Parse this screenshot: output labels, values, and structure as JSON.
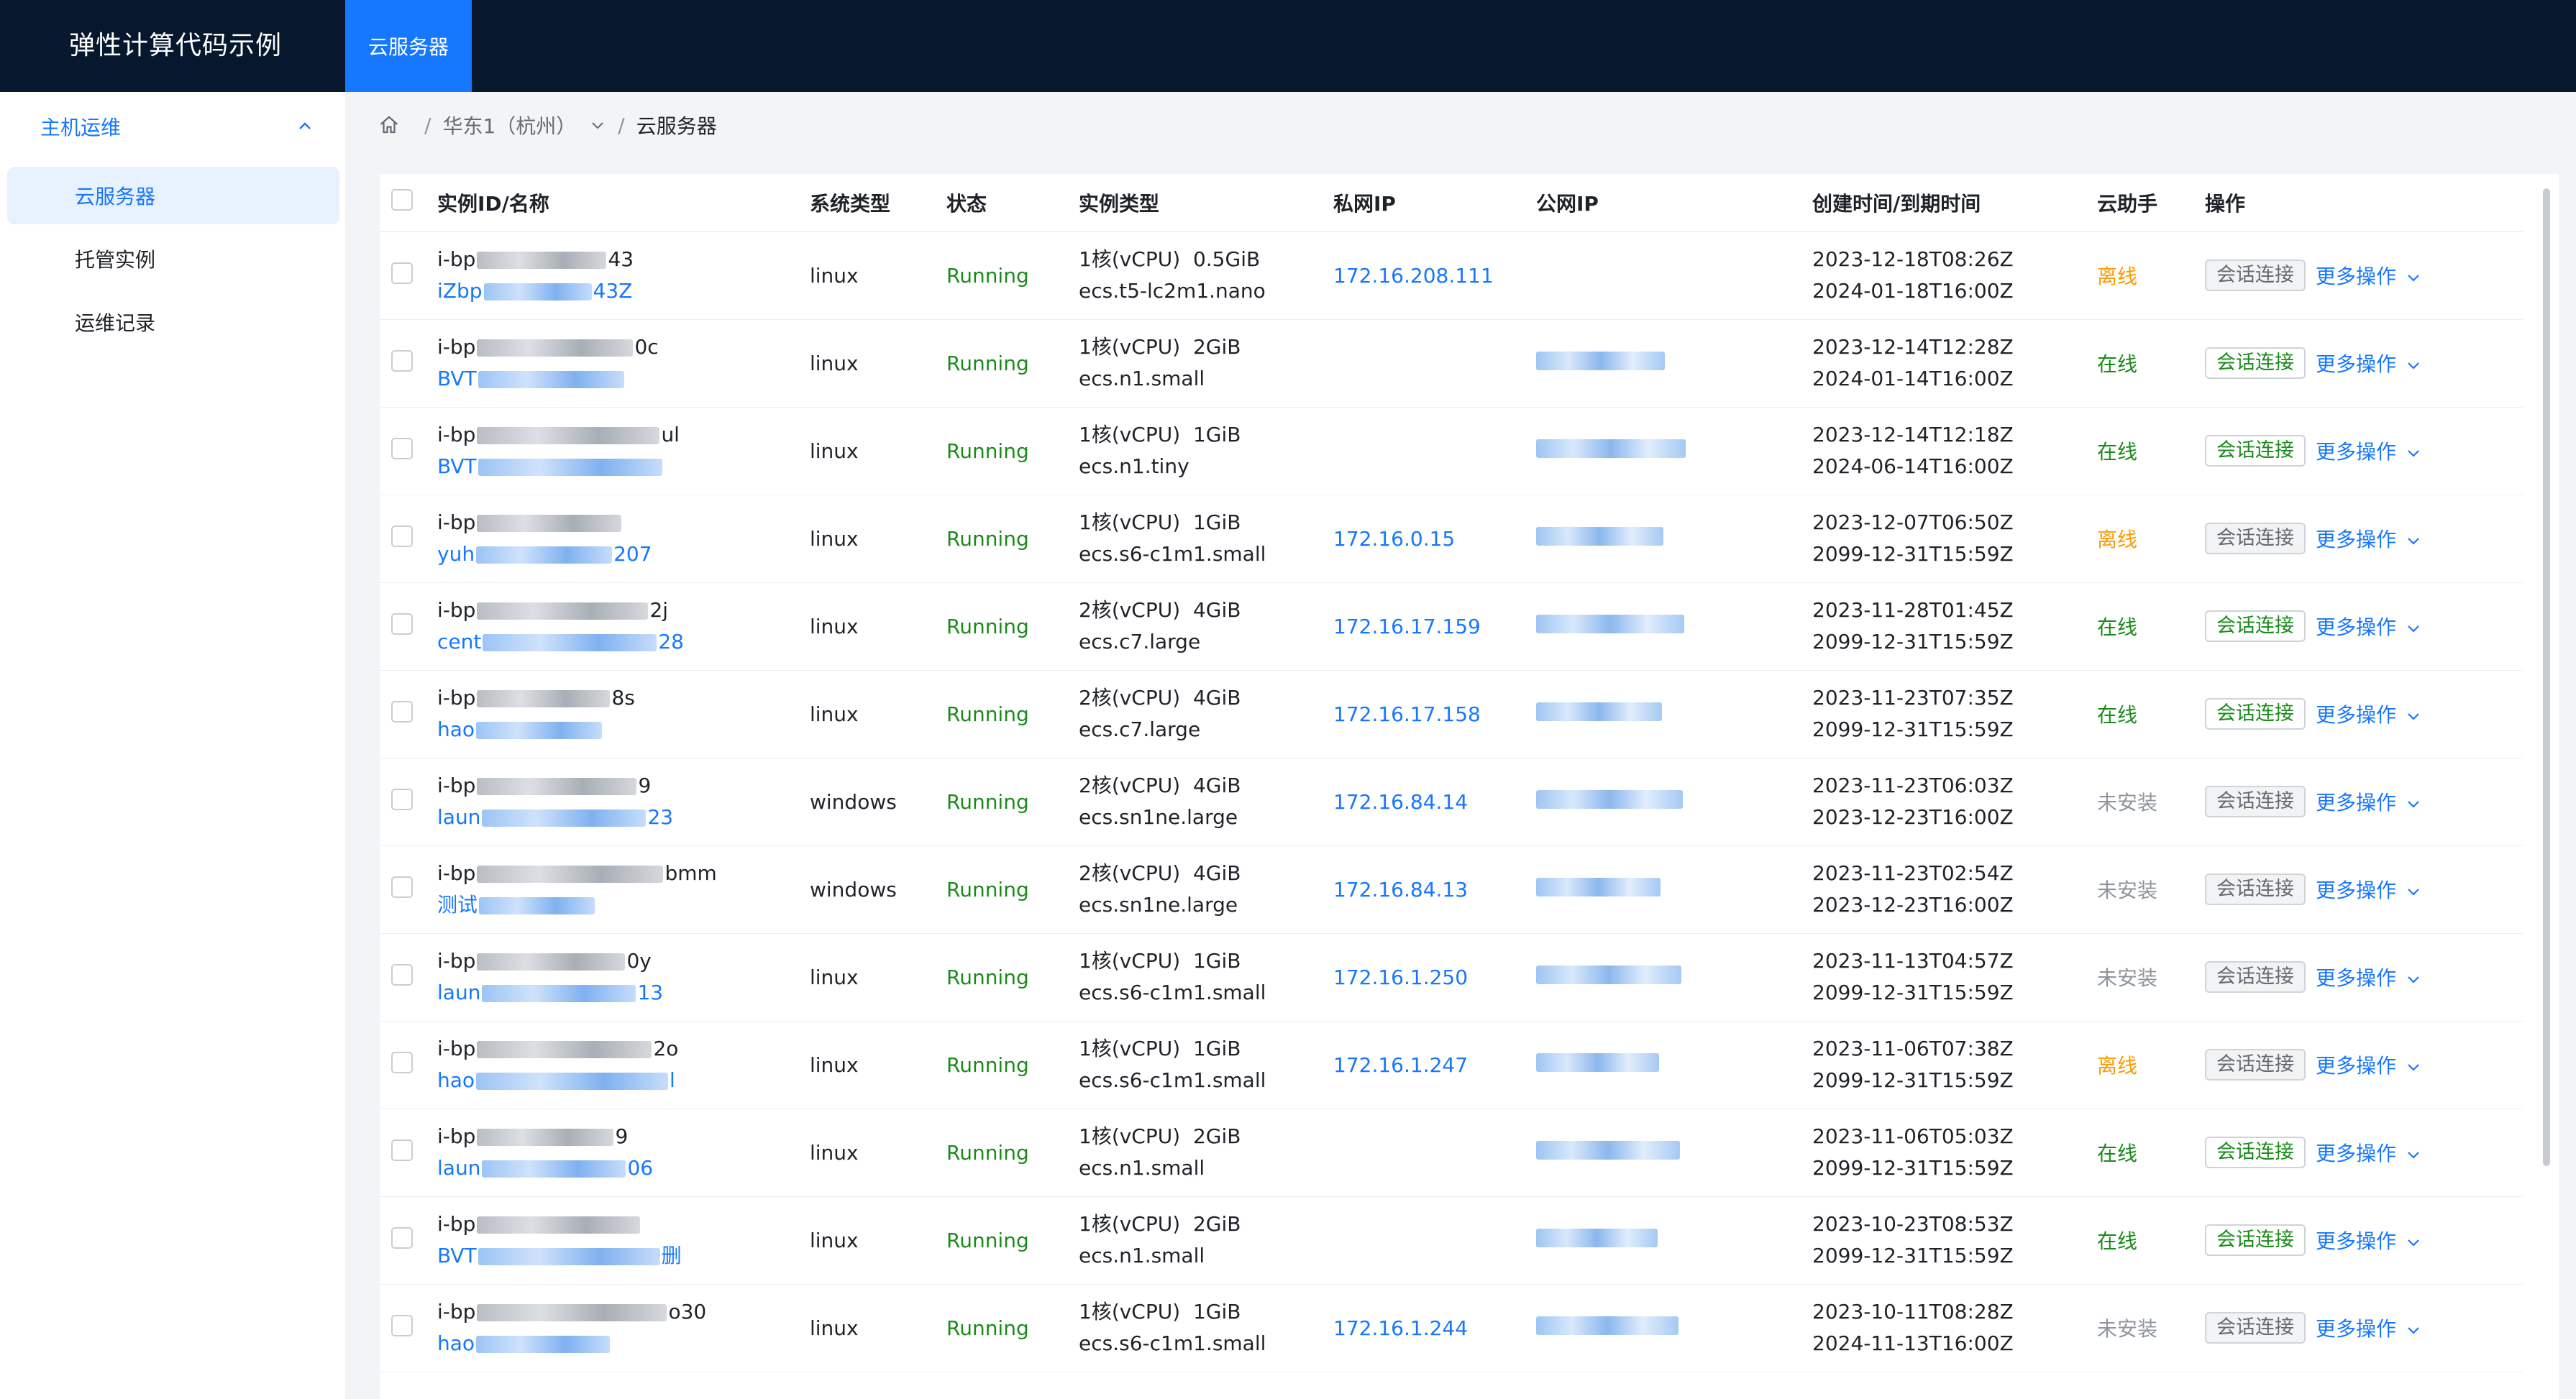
{
  "app": {
    "title": "弹性计算代码示例",
    "top_tab": "云服务器"
  },
  "sidebar": {
    "group": "主机运维",
    "items": [
      {
        "label": "云服务器",
        "active": true
      },
      {
        "label": "托管实例",
        "active": false
      },
      {
        "label": "运维记录",
        "active": false
      }
    ]
  },
  "breadcrumb": {
    "region": "华东1（杭州）",
    "sep": "/",
    "current": "云服务器"
  },
  "table": {
    "headers": [
      "实例ID/名称",
      "系统类型",
      "状态",
      "实例类型",
      "私网IP",
      "公网IP",
      "创建时间/到期时间",
      "云助手",
      "操作"
    ],
    "connect_label": "会话连接",
    "more_label": "更多操作",
    "rows": [
      {
        "id_prefix": "i-bp",
        "id_suffix": "43",
        "name_prefix": "iZbp",
        "name_suffix": "43Z",
        "os": "linux",
        "status": "Running",
        "spec": "1核(vCPU)  0.5GiB",
        "type": "ecs.t5-lc2m1.nano",
        "private_ip": "172.16.208.111",
        "public_ip": false,
        "created": "2023-12-18T08:26Z",
        "expires": "2024-01-18T16:00Z",
        "assistant": "离线",
        "assistant_state": "off"
      },
      {
        "id_prefix": "i-bp",
        "id_suffix": "0c",
        "name_prefix": "BVT",
        "name_suffix": "",
        "os": "linux",
        "status": "Running",
        "spec": "1核(vCPU)  2GiB",
        "type": "ecs.n1.small",
        "private_ip": "",
        "public_ip": true,
        "created": "2023-12-14T12:28Z",
        "expires": "2024-01-14T16:00Z",
        "assistant": "在线",
        "assistant_state": "on"
      },
      {
        "id_prefix": "i-bp",
        "id_suffix": "ul",
        "name_prefix": "BVT",
        "name_suffix": "",
        "os": "linux",
        "status": "Running",
        "spec": "1核(vCPU)  1GiB",
        "type": "ecs.n1.tiny",
        "private_ip": "",
        "public_ip": true,
        "created": "2023-12-14T12:18Z",
        "expires": "2024-06-14T16:00Z",
        "assistant": "在线",
        "assistant_state": "on"
      },
      {
        "id_prefix": "i-bp",
        "id_suffix": "",
        "name_prefix": "yuh",
        "name_suffix": "207",
        "os": "linux",
        "status": "Running",
        "spec": "1核(vCPU)  1GiB",
        "type": "ecs.s6-c1m1.small",
        "private_ip": "172.16.0.15",
        "public_ip": true,
        "created": "2023-12-07T06:50Z",
        "expires": "2099-12-31T15:59Z",
        "assistant": "离线",
        "assistant_state": "off"
      },
      {
        "id_prefix": "i-bp",
        "id_suffix": "2j",
        "name_prefix": "cent",
        "name_suffix": "28",
        "os": "linux",
        "status": "Running",
        "spec": "2核(vCPU)  4GiB",
        "type": "ecs.c7.large",
        "private_ip": "172.16.17.159",
        "public_ip": true,
        "created": "2023-11-28T01:45Z",
        "expires": "2099-12-31T15:59Z",
        "assistant": "在线",
        "assistant_state": "on"
      },
      {
        "id_prefix": "i-bp",
        "id_suffix": "8s",
        "name_prefix": "hao",
        "name_suffix": "",
        "os": "linux",
        "status": "Running",
        "spec": "2核(vCPU)  4GiB",
        "type": "ecs.c7.large",
        "private_ip": "172.16.17.158",
        "public_ip": true,
        "created": "2023-11-23T07:35Z",
        "expires": "2099-12-31T15:59Z",
        "assistant": "在线",
        "assistant_state": "on"
      },
      {
        "id_prefix": "i-bp",
        "id_suffix": "9",
        "name_prefix": "laun",
        "name_suffix": "23",
        "os": "windows",
        "status": "Running",
        "spec": "2核(vCPU)  4GiB",
        "type": "ecs.sn1ne.large",
        "private_ip": "172.16.84.14",
        "public_ip": true,
        "created": "2023-11-23T06:03Z",
        "expires": "2023-12-23T16:00Z",
        "assistant": "未安装",
        "assistant_state": "na"
      },
      {
        "id_prefix": "i-bp",
        "id_suffix": "bmm",
        "name_prefix": "测试",
        "name_suffix": "",
        "os": "windows",
        "status": "Running",
        "spec": "2核(vCPU)  4GiB",
        "type": "ecs.sn1ne.large",
        "private_ip": "172.16.84.13",
        "public_ip": true,
        "created": "2023-11-23T02:54Z",
        "expires": "2023-12-23T16:00Z",
        "assistant": "未安装",
        "assistant_state": "na"
      },
      {
        "id_prefix": "i-bp",
        "id_suffix": "0y",
        "name_prefix": "laun",
        "name_suffix": "13",
        "os": "linux",
        "status": "Running",
        "spec": "1核(vCPU)  1GiB",
        "type": "ecs.s6-c1m1.small",
        "private_ip": "172.16.1.250",
        "public_ip": true,
        "created": "2023-11-13T04:57Z",
        "expires": "2099-12-31T15:59Z",
        "assistant": "未安装",
        "assistant_state": "na"
      },
      {
        "id_prefix": "i-bp",
        "id_suffix": "2o",
        "name_prefix": "hao",
        "name_suffix": "l",
        "os": "linux",
        "status": "Running",
        "spec": "1核(vCPU)  1GiB",
        "type": "ecs.s6-c1m1.small",
        "private_ip": "172.16.1.247",
        "public_ip": true,
        "created": "2023-11-06T07:38Z",
        "expires": "2099-12-31T15:59Z",
        "assistant": "离线",
        "assistant_state": "off"
      },
      {
        "id_prefix": "i-bp",
        "id_suffix": "9",
        "name_prefix": "laun",
        "name_suffix": "06",
        "os": "linux",
        "status": "Running",
        "spec": "1核(vCPU)  2GiB",
        "type": "ecs.n1.small",
        "private_ip": "",
        "public_ip": true,
        "created": "2023-11-06T05:03Z",
        "expires": "2099-12-31T15:59Z",
        "assistant": "在线",
        "assistant_state": "on"
      },
      {
        "id_prefix": "i-bp",
        "id_suffix": "",
        "name_prefix": "BVT",
        "name_suffix": "删",
        "os": "linux",
        "status": "Running",
        "spec": "1核(vCPU)  2GiB",
        "type": "ecs.n1.small",
        "private_ip": "",
        "public_ip": true,
        "created": "2023-10-23T08:53Z",
        "expires": "2099-12-31T15:59Z",
        "assistant": "在线",
        "assistant_state": "on"
      },
      {
        "id_prefix": "i-bp",
        "id_suffix": "o30",
        "name_prefix": "hao",
        "name_suffix": "",
        "os": "linux",
        "status": "Running",
        "spec": "1核(vCPU)  1GiB",
        "type": "ecs.s6-c1m1.small",
        "private_ip": "172.16.1.244",
        "public_ip": true,
        "created": "2023-10-11T08:28Z",
        "expires": "2024-11-13T16:00Z",
        "assistant": "未安装",
        "assistant_state": "na"
      }
    ]
  },
  "colors": {
    "nav_bg": "#06172e",
    "accent": "#1677ff",
    "running": "#1a8b1a",
    "offline": "#ff9a00",
    "not_installed": "#8f959e"
  }
}
